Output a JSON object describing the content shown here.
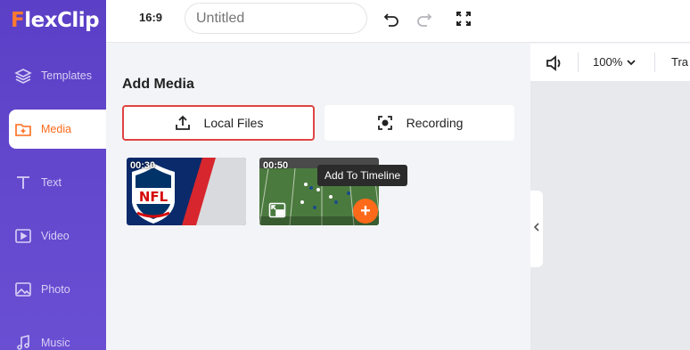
{
  "app": {
    "logo_prefix": "F",
    "logo_rest": "lexClip"
  },
  "sidebar": {
    "items": [
      {
        "label": "Templates",
        "icon": "layers-icon"
      },
      {
        "label": "Media",
        "icon": "folder-plus-icon",
        "active": true
      },
      {
        "label": "Text",
        "icon": "text-icon"
      },
      {
        "label": "Video",
        "icon": "video-icon"
      },
      {
        "label": "Photo",
        "icon": "photo-icon"
      },
      {
        "label": "Music",
        "icon": "music-icon"
      }
    ]
  },
  "topbar": {
    "ratio": "16:9",
    "title_placeholder": "Untitled",
    "icons": [
      "undo-icon",
      "redo-icon",
      "fullscreen-icon"
    ]
  },
  "panel": {
    "title": "Add Media",
    "local_files_label": "Local Files",
    "recording_label": "Recording",
    "media": [
      {
        "duration": "00:30",
        "name": "NFL logo clip"
      },
      {
        "duration": "00:50",
        "name": "Football field clip"
      }
    ],
    "tooltip": "Add To Timeline"
  },
  "canvas_toolbar": {
    "zoom": "100%",
    "transition_label": "Tra"
  },
  "colors": {
    "sidebar": "#5b3fc6",
    "accent": "#ff6a1a",
    "highlight_border": "#e04343"
  }
}
